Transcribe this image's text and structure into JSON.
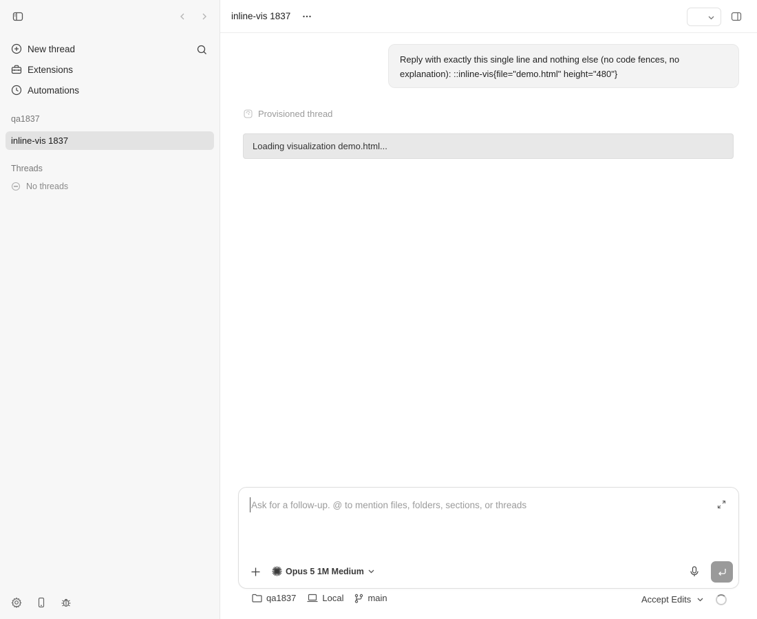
{
  "sidebar": {
    "nav": [
      {
        "label": "New thread",
        "icon": "plus-circle-icon"
      },
      {
        "label": "Extensions",
        "icon": "toolbox-icon"
      },
      {
        "label": "Automations",
        "icon": "clock-icon"
      }
    ],
    "workspace_label": "qa1837",
    "active_thread": "inline-vis 1837",
    "threads_label": "Threads",
    "no_threads": "No threads"
  },
  "header": {
    "title": "inline-vis 1837"
  },
  "conversation": {
    "user_message": "Reply with exactly this single line and nothing else (no code fences, no explanation): ::inline-vis{file=\"demo.html\" height=\"480\"}",
    "status_text": "Provisioned thread",
    "loading_text": "Loading visualization demo.html..."
  },
  "composer": {
    "placeholder": "Ask for a follow-up. @ to mention files, folders, sections, or threads",
    "value": "",
    "model": "Opus 5 1M Medium"
  },
  "footer": {
    "folder": "qa1837",
    "environment": "Local",
    "branch": "main",
    "mode": "Accept Edits"
  },
  "colors": {
    "sidebar_bg": "#f7f7f7",
    "active_item_bg": "#e3e3e3",
    "bubble_bg": "#f3f3f3",
    "loading_bg": "#e8e8e8",
    "send_button": "#9a9a9a"
  }
}
